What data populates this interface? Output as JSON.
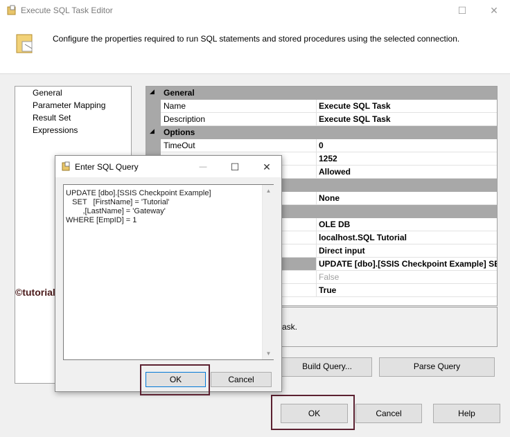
{
  "window": {
    "title": "Execute SQL Task Editor",
    "header_text": "Configure the properties required to run SQL statements and stored procedures using the selected connection."
  },
  "nav": {
    "items": [
      "General",
      "Parameter Mapping",
      "Result Set",
      "Expressions"
    ]
  },
  "grid": {
    "rows": [
      {
        "kind": "cat",
        "label": "General"
      },
      {
        "kind": "prop",
        "name": "Name",
        "value": "Execute SQL Task"
      },
      {
        "kind": "prop",
        "name": "Description",
        "value": "Execute SQL Task"
      },
      {
        "kind": "cat",
        "label": "Options"
      },
      {
        "kind": "prop",
        "name": "TimeOut",
        "value": "0"
      },
      {
        "kind": "prop",
        "name": "",
        "value": "1252"
      },
      {
        "kind": "prop",
        "name": "",
        "value": "Allowed"
      },
      {
        "kind": "cat",
        "label": ""
      },
      {
        "kind": "prop",
        "name": "",
        "value": "None"
      },
      {
        "kind": "cat",
        "label": ""
      },
      {
        "kind": "prop",
        "name": "",
        "value": "OLE DB"
      },
      {
        "kind": "prop",
        "name": "",
        "value": "localhost.SQL Tutorial"
      },
      {
        "kind": "prop",
        "name": "",
        "value": "Direct input"
      },
      {
        "kind": "prop",
        "name": "",
        "value": "UPDATE [dbo].[SSIS Checkpoint Example]    SET",
        "selected": true
      },
      {
        "kind": "prop",
        "name": "",
        "value": "False",
        "dim": true
      },
      {
        "kind": "prop",
        "name": "",
        "value": "True"
      }
    ]
  },
  "description_fragment": "ask.",
  "buttons": {
    "build_query": "Build Query...",
    "parse_query": "Parse Query",
    "ok": "OK",
    "cancel": "Cancel",
    "help": "Help"
  },
  "dialog": {
    "title": "Enter SQL Query",
    "sql": "UPDATE [dbo].[SSIS Checkpoint Example]\n   SET   [FirstName] = 'Tutorial'\n        ,[LastName] = 'Gateway'\nWHERE [EmpID] = 1",
    "ok": "OK",
    "cancel": "Cancel",
    "min_glyph": "—",
    "max_glyph": "☐",
    "close_glyph": "✕"
  },
  "watermark": "©tutorialgateway.org",
  "colors": {
    "highlight": "#5b2030",
    "category": "#a8a8a8"
  }
}
